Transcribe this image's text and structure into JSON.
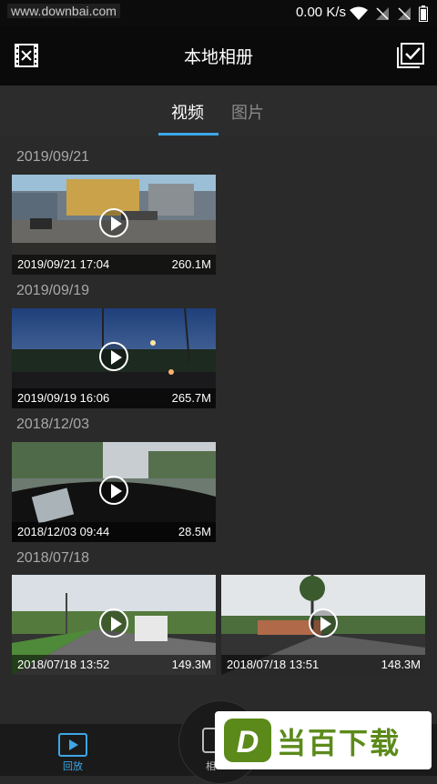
{
  "status_bar": {
    "watermark": "www.downbai.com",
    "net_speed": "0.00 K/s"
  },
  "app_bar": {
    "title": "本地相册"
  },
  "tabs": [
    {
      "label": "视频",
      "active": true
    },
    {
      "label": "图片",
      "active": false
    }
  ],
  "groups": [
    {
      "date": "2019/09/21",
      "items": [
        {
          "time": "2019/09/21 17:04",
          "size": "260.1M"
        }
      ]
    },
    {
      "date": "2019/09/19",
      "items": [
        {
          "time": "2019/09/19 16:06",
          "size": "265.7M"
        }
      ]
    },
    {
      "date": "2018/12/03",
      "items": [
        {
          "time": "2018/12/03 09:44",
          "size": "28.5M"
        }
      ]
    },
    {
      "date": "2018/07/18",
      "items": [
        {
          "time": "2018/07/18 13:52",
          "size": "149.3M"
        },
        {
          "time": "2018/07/18 13:51",
          "size": "148.3M"
        }
      ]
    }
  ],
  "bottom_nav": {
    "playback_label": "回放",
    "center_label": "相"
  },
  "logo": {
    "letter": "D",
    "text": "当百下载"
  },
  "colors": {
    "accent": "#3da7e6",
    "background": "#2a2a2a",
    "app_bar": "#0a0a0a",
    "logo_green": "#5b8a1a"
  }
}
